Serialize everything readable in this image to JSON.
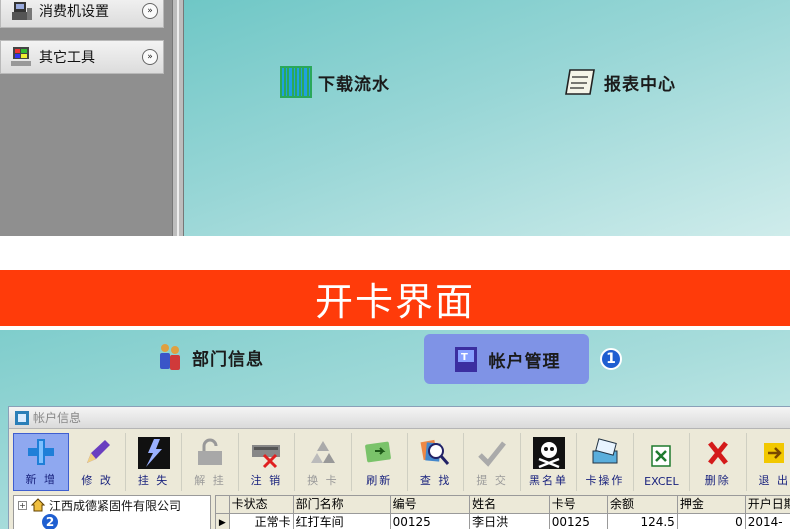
{
  "sidebar": {
    "items": [
      {
        "label": "消费机设置",
        "icon": "pos-terminal-icon",
        "chevron": "»"
      },
      {
        "label": "其它工具",
        "icon": "computer-tools-icon",
        "chevron": "»"
      }
    ]
  },
  "top_actions": {
    "download_flow": {
      "label": "下载流水",
      "icon": "barcode-icon"
    },
    "report_center": {
      "label": "报表中心",
      "icon": "notepad-icon"
    }
  },
  "banner": {
    "text": "开卡界面"
  },
  "nav_tabs": {
    "dept_info": {
      "label": "部门信息",
      "icon": "people-icon"
    },
    "account_mgmt": {
      "label": "帐户管理",
      "icon": "account-card-icon"
    },
    "badge_1": "1",
    "badge_2": "2"
  },
  "window": {
    "title": "帐户信息",
    "toolbar": [
      {
        "label": "新 增",
        "icon": "add-icon",
        "active": true,
        "disabled": false
      },
      {
        "label": "修 改",
        "icon": "pencil-icon",
        "active": false,
        "disabled": false
      },
      {
        "label": "挂 失",
        "icon": "lightning-icon",
        "active": false,
        "disabled": false
      },
      {
        "label": "解 挂",
        "icon": "unlock-icon",
        "active": false,
        "disabled": true
      },
      {
        "label": "注 销",
        "icon": "cancel-card-icon",
        "active": false,
        "disabled": false
      },
      {
        "label": "换 卡",
        "icon": "recycle-icon",
        "active": false,
        "disabled": true
      },
      {
        "label": "刷新",
        "icon": "refresh-icon",
        "active": false,
        "disabled": false
      },
      {
        "label": "查 找",
        "icon": "search-icon",
        "active": false,
        "disabled": false
      },
      {
        "label": "提 交",
        "icon": "submit-icon",
        "active": false,
        "disabled": true
      },
      {
        "label": "黑名单",
        "icon": "skull-icon",
        "active": false,
        "disabled": false
      },
      {
        "label": "卡操作",
        "icon": "card-operation-icon",
        "active": false,
        "disabled": false
      },
      {
        "label": "EXCEL",
        "icon": "excel-icon",
        "active": false,
        "disabled": false
      },
      {
        "label": "删除",
        "icon": "delete-icon",
        "active": false,
        "disabled": false
      },
      {
        "label": "退 出",
        "icon": "exit-icon",
        "active": false,
        "disabled": false
      }
    ],
    "tree": {
      "root_label": "江西成德紧固件有限公司",
      "expander": "+"
    },
    "grid": {
      "columns": [
        "卡状态",
        "部门名称",
        "编号",
        "姓名",
        "卡号",
        "余额",
        "押金",
        "开户日期"
      ],
      "rows": [
        [
          "正常卡",
          "红打车间",
          "00125",
          "李日洪",
          "00125",
          "124.5",
          "0",
          "2014-"
        ]
      ],
      "row_indicator": "▶"
    }
  },
  "colors": {
    "banner": "#ff3b0a",
    "teal_panel": "#8fd3d2",
    "active_tab": "#7f93e6",
    "badge": "#1f5fd1"
  }
}
